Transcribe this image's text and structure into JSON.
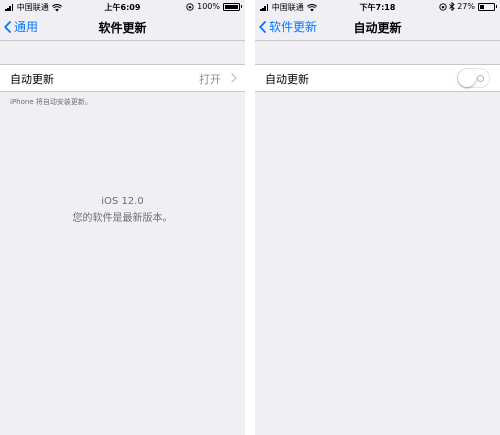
{
  "left": {
    "status": {
      "carrier": "中国联通",
      "time": "上午6:09",
      "battery": "100%",
      "battery_level": 1.0
    },
    "nav": {
      "back_label": "通用",
      "title": "软件更新"
    },
    "auto_update": {
      "label": "自动更新",
      "value": "打开"
    },
    "footnote": "iPhone 将自动安装更新。",
    "version": "iOS 12.0",
    "message": "您的软件是最新版本。"
  },
  "right": {
    "status": {
      "carrier": "中国联通",
      "time": "下午7:18",
      "battery": "27%",
      "battery_level": 0.27
    },
    "nav": {
      "back_label": "软件更新",
      "title": "自动更新"
    },
    "auto_update": {
      "label": "自动更新",
      "toggle_on": false
    }
  },
  "colors": {
    "accent": "#007aff",
    "background": "#efeff4",
    "separator": "#c8c7cc"
  }
}
